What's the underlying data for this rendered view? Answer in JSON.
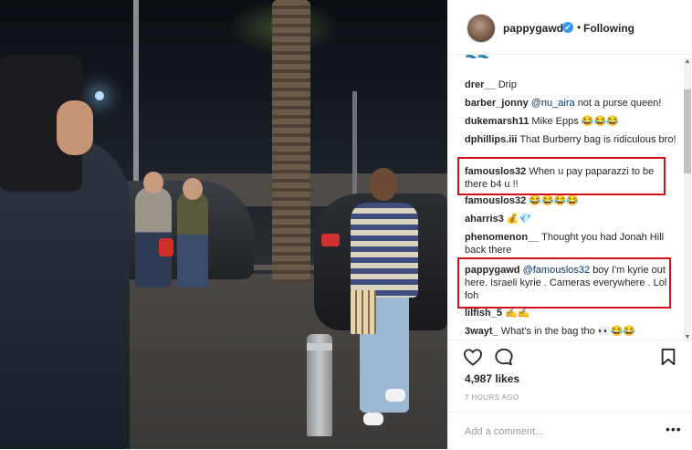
{
  "post": {
    "username": "pappygawd",
    "verified_mark": "✔",
    "separator": "•",
    "follow_status": "Following"
  },
  "comments": [
    {
      "user": "",
      "text": "🌊🌊"
    },
    {
      "user": "drer__",
      "text": "Drip"
    },
    {
      "user": "barber_jonny",
      "mention": "@nu_aira",
      "text": "not a purse queen!"
    },
    {
      "user": "dukemarsh11",
      "text": "Mike Epps 😂😂😂"
    },
    {
      "user": "dphillips.iii",
      "text": "That Burberry bag is ridiculous bro!"
    },
    {
      "user": "famouslos32",
      "text": "When u pay paparazzi to be there b4 u !!"
    },
    {
      "user": "famouslos32",
      "text": "😂😂😂😂"
    },
    {
      "user": "aharris3",
      "text": "💰💎"
    },
    {
      "user": "phenomenon__",
      "text": "Thought you had Jonah Hill back there"
    },
    {
      "user": "pappygawd",
      "mention": "@famouslos32",
      "text": "boy I'm kyrie out here. Israeli kyrie . Cameras everywhere . Lol foh"
    },
    {
      "user": "lilfish_5",
      "text": "✍️✍️"
    },
    {
      "user": "3wayt_",
      "text": "What's in the bag tho 👀😂😂"
    }
  ],
  "likes_text": "4,987 likes",
  "time_text": "7 HOURS AGO",
  "add_comment_placeholder": "Add a comment...",
  "more_label": "•••",
  "colors": {
    "highlight": "#d0101a",
    "verified": "#3897f0",
    "mention": "#003569"
  }
}
